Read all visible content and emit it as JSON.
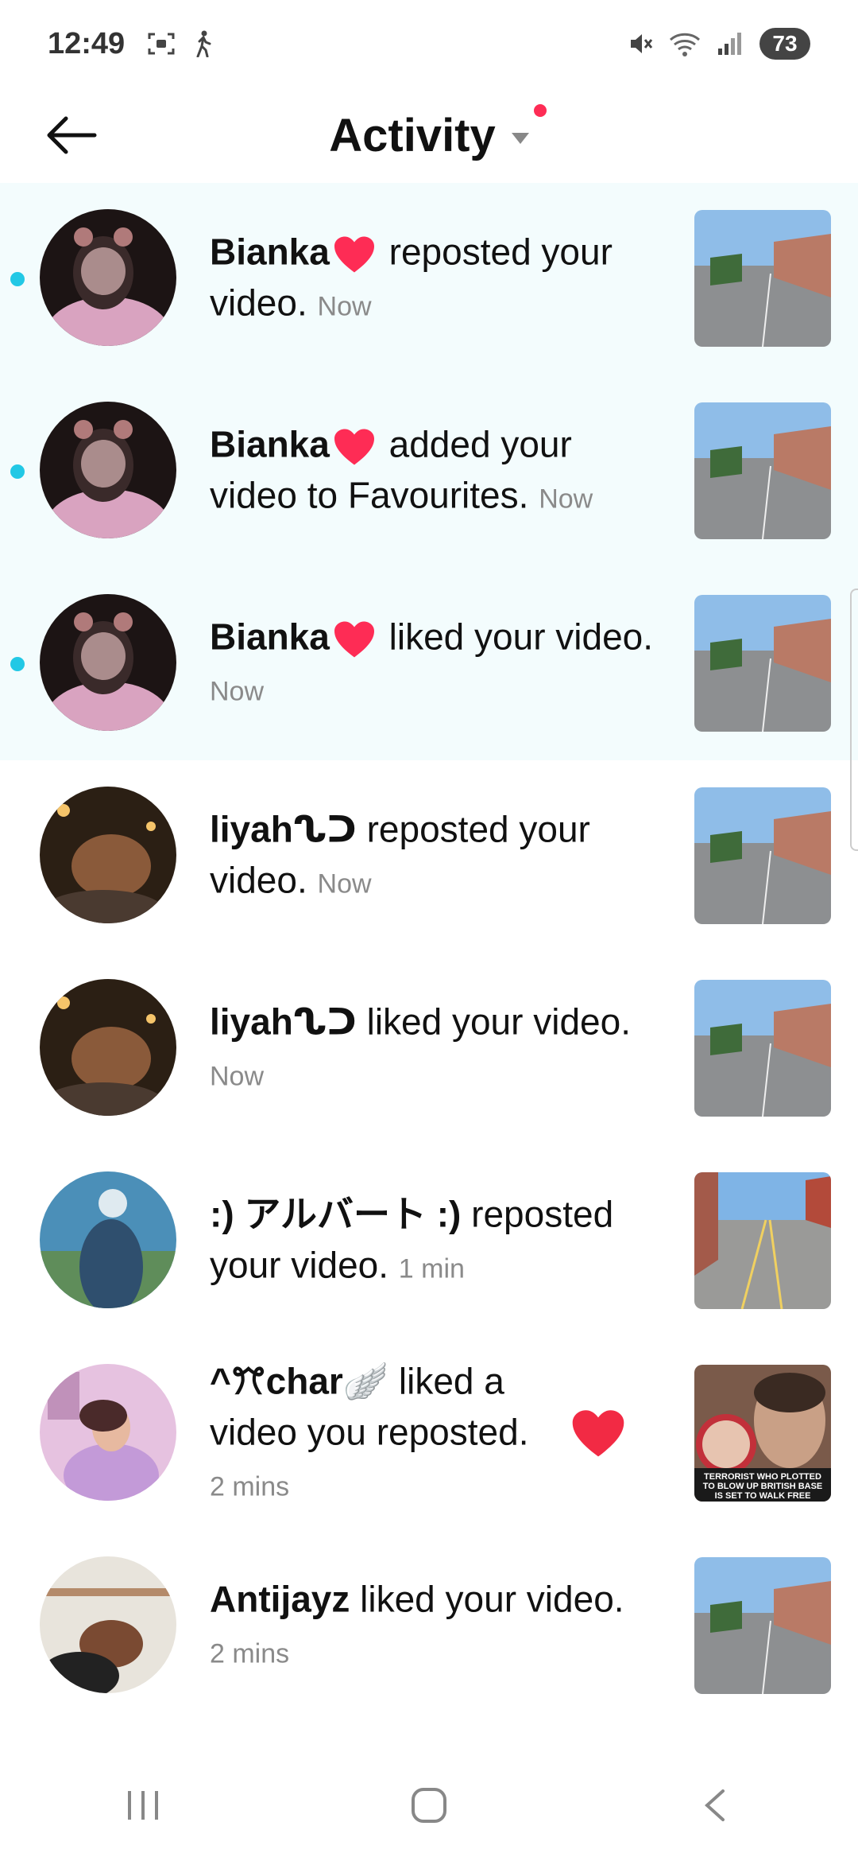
{
  "status_bar": {
    "time": "12:49",
    "battery": "73",
    "icons": [
      "screen-record-icon",
      "walking-icon",
      "mute-icon",
      "wifi-icon",
      "signal-icon"
    ]
  },
  "header": {
    "title": "Activity",
    "back_icon": "arrow-left-icon",
    "dropdown_icon": "chevron-down-icon"
  },
  "colors": {
    "unread_bg": "#f3fcfd",
    "unread_dot": "#22c8e5",
    "heart": "#fe2c55",
    "time_text": "#8a8a8a"
  },
  "notifications": [
    {
      "user": "Bianka",
      "has_heart": true,
      "action": " reposted your video. ",
      "time": "Now",
      "unread": true
    },
    {
      "user": "Bianka",
      "has_heart": true,
      "action": " added your video to Favourites. ",
      "time": "Now",
      "unread": true
    },
    {
      "user": "Bianka",
      "has_heart": true,
      "action": " liked your video. ",
      "time": "Now",
      "unread": true
    },
    {
      "user": "liyahᔐᑐ",
      "has_heart": false,
      "action": " reposted your video. ",
      "time": "Now",
      "unread": false
    },
    {
      "user": "liyahᔐᑐ",
      "has_heart": false,
      "action": " liked your video. ",
      "time": "Now",
      "unread": false
    },
    {
      "user": ":) アルバート :)",
      "has_heart": false,
      "action": " reposted your video. ",
      "time": "1 min",
      "unread": false
    },
    {
      "user": "^ꔫchar🪽",
      "has_heart": false,
      "action": " liked a video you reposted. ",
      "time": "2 mins",
      "unread": false,
      "like_icon": "heart-icon"
    },
    {
      "user": "Antijayz",
      "has_heart": false,
      "action": " liked your video. ",
      "time": "2 mins",
      "unread": false
    }
  ],
  "thumb_texts": {
    "news_line1": "TERRORIST WHO PLOTTED",
    "news_line2": "TO BLOW UP BRITISH BASE",
    "news_line3": "IS SET TO WALK FREE"
  },
  "nav": {
    "recents_icon": "recents-icon",
    "home_icon": "home-icon",
    "back_icon": "nav-back-icon"
  }
}
